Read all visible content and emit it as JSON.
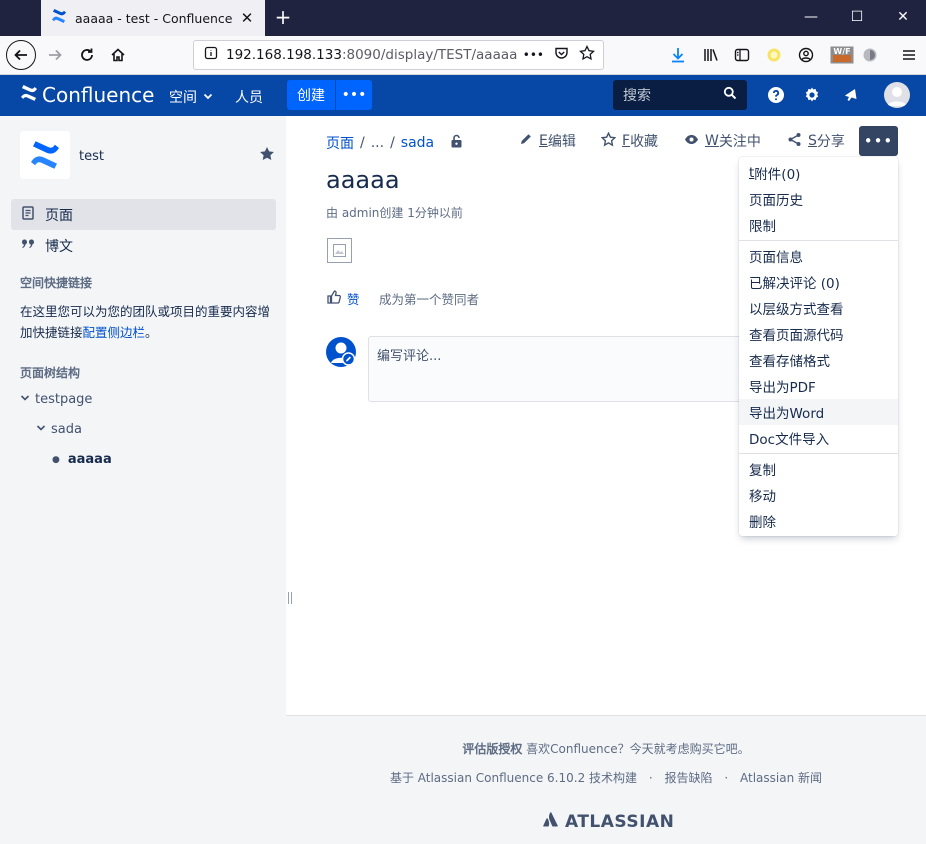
{
  "browser": {
    "tab_title": "aaaaa - test - Confluence",
    "url_host": "192.168.198.133",
    "url_path": ":8090/display/TEST/aaaaa",
    "urlbar_more": "•••"
  },
  "header": {
    "logo_text": "Confluence",
    "nav_spaces": "空间",
    "nav_people": "人员",
    "create_label": "创建",
    "create_more": "•••",
    "search_placeholder": "搜索"
  },
  "sidebar": {
    "space_name": "test",
    "items": [
      {
        "label": "页面"
      },
      {
        "label": "博文"
      }
    ],
    "shortcuts_heading": "空间快捷链接",
    "shortcuts_text": "在这里您可以为您的团队或项目的重要内容增加快捷链接",
    "shortcuts_link": "配置侧边栏",
    "shortcuts_end": "。",
    "tree_heading": "页面树结构",
    "tree": [
      {
        "label": "testpage"
      },
      {
        "label": "sada"
      },
      {
        "label": "aaaaa"
      }
    ]
  },
  "content": {
    "breadcrumb_root": "页面",
    "breadcrumb_ellipsis": "...",
    "breadcrumb_parent": "sada",
    "actions": {
      "edit_key": "E",
      "edit_label": "编辑",
      "favorite_key": "F",
      "favorite_label": "收藏",
      "watch_key": "W",
      "watch_label": "关注中",
      "share_key": "S",
      "share_label": "分享"
    },
    "more_label": "•••",
    "title": "aaaaa",
    "byline": "由 admin创建 1分钟以前",
    "like_label": "赞",
    "like_hint": "成为第一个赞同者",
    "comment_placeholder": "编写评论..."
  },
  "more_menu": {
    "group1": [
      {
        "key": "t",
        "label": "附件(0)"
      },
      {
        "key": "",
        "label": "页面历史"
      },
      {
        "key": "",
        "label": "限制"
      }
    ],
    "group2": [
      {
        "label": "页面信息"
      },
      {
        "label": "已解决评论 (0)"
      },
      {
        "label": "以层级方式查看"
      },
      {
        "label": "查看页面源代码"
      },
      {
        "label": "查看存储格式"
      },
      {
        "label": "导出为PDF"
      },
      {
        "label": "导出为Word"
      },
      {
        "label": "Doc文件导入"
      }
    ],
    "group3": [
      {
        "label": "复制"
      },
      {
        "label": "移动"
      },
      {
        "label": "删除"
      }
    ],
    "hovered": "导出为Word"
  },
  "footer": {
    "eval_bold": "评估版授权",
    "eval_text": " 喜欢Confluence？今天就考虑购买它吧。",
    "powered": "基于 Atlassian Confluence 6.10.2 技术构建",
    "dot": "·",
    "report": "报告缺陷",
    "news": "Atlassian 新闻",
    "atlassian": "ATLASSIAN"
  },
  "colors": {
    "header_bg": "#0747a6",
    "create_bg": "#0065ff",
    "link": "#0052cc",
    "sidebar_bg": "#f4f5f7",
    "more_btn_bg": "#344563"
  }
}
